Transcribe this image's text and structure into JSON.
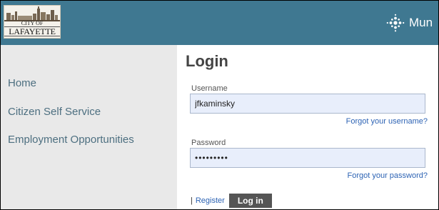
{
  "header": {
    "logo": {
      "line1": "CITY OF",
      "line2": "LAFAYETTE"
    },
    "brand_name": "Mun",
    "brand_icon": "sparkle-dots-icon",
    "background": "#3f7891"
  },
  "sidebar": {
    "items": [
      {
        "label": "Home"
      },
      {
        "label": "Citizen Self Service"
      },
      {
        "label": "Employment Opportunities"
      }
    ]
  },
  "login": {
    "title": "Login",
    "username_label": "Username",
    "username_value": "jfkaminsky",
    "forgot_username": "Forgot your username?",
    "password_label": "Password",
    "password_value": "•••••••••",
    "forgot_password": "Forgot your password?",
    "separator": "|",
    "register": "Register",
    "login_button": "Log in"
  }
}
